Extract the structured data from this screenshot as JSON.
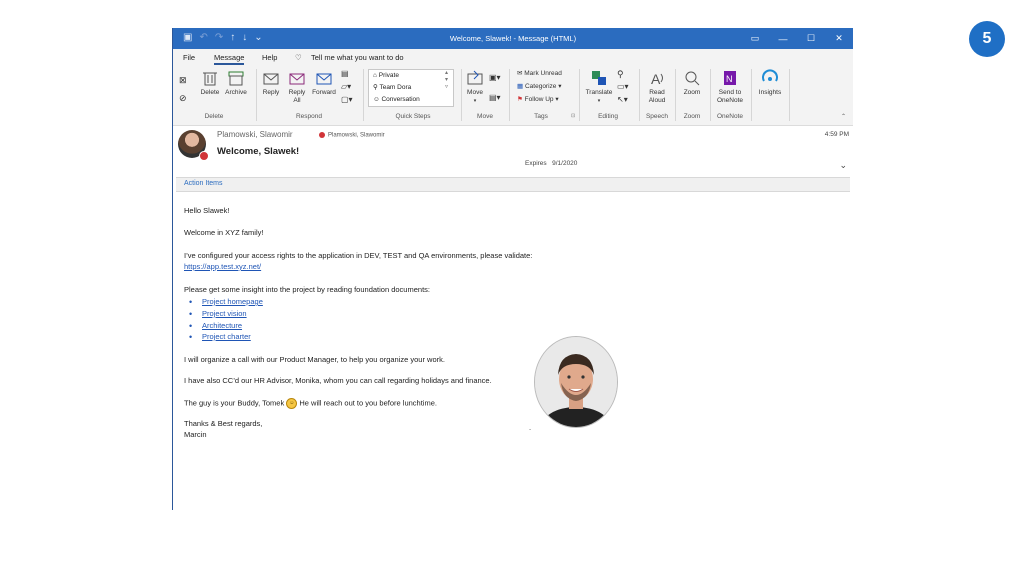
{
  "slide_number": "5",
  "window": {
    "title": "Welcome, Slawek!  -  Message (HTML)"
  },
  "tabs": {
    "file": "File",
    "message": "Message",
    "help": "Help",
    "tell_me": "Tell me what you want to do"
  },
  "ribbon": {
    "delete": "Delete",
    "archive": "Archive",
    "reply": "Reply",
    "reply_all_1": "Reply",
    "reply_all_2": "All",
    "forward": "Forward",
    "quick_steps": [
      "Private",
      "Team Dora",
      "Conversation"
    ],
    "move": "Move",
    "mark_unread": "Mark Unread",
    "categorize": "Categorize",
    "follow_up": "Follow Up",
    "translate": "Translate",
    "read_aloud_1": "Read",
    "read_aloud_2": "Aloud",
    "zoom": "Zoom",
    "send_onenote_1": "Send to",
    "send_onenote_2": "OneNote",
    "insights": "Insights",
    "groups": {
      "delete": "Delete",
      "respond": "Respond",
      "quick_steps": "Quick Steps",
      "move": "Move",
      "tags": "Tags",
      "editing": "Editing",
      "speech": "Speech",
      "zoom": "Zoom",
      "onenote": "OneNote"
    }
  },
  "message": {
    "sender": "Plamowski, Slawomir",
    "to": "Plamowski, Slawomir",
    "subject": "Welcome, Slawek!",
    "time": "4:59 PM",
    "expires_label": "Expires",
    "expires_date": "9/1/2020",
    "action_items": "Action Items"
  },
  "body": {
    "greeting": "Hello Slawek!",
    "welcome": "Welcome in XYZ  family!",
    "access": "I’ve configured your access rights to the application in DEV, TEST and QA environments, please validate:",
    "app_link": "https://app.test.xyz.net/",
    "insight": "Please get some insight into the project by reading foundation documents:",
    "docs": [
      "Project homepage",
      "Project vision",
      "Architecture",
      "Project charter"
    ],
    "call": "I  will organize a call with our Product Manager, to help you organize your work.",
    "hr": "I have also CC’d our HR Advisor, Monika, whom you can call regarding holidays and finance.",
    "buddy_a": "The guy is your Buddy, Tomek",
    "buddy_b": "He will reach out to you before lunchtime.",
    "regards": "Thanks & Best regards,",
    "signature": "Marcin",
    "dot": "."
  },
  "colors": {
    "titlebar": "#2b6cbf",
    "accent": "#2b579a",
    "link": "#1f55b5",
    "presence_busy": "#d13438"
  }
}
